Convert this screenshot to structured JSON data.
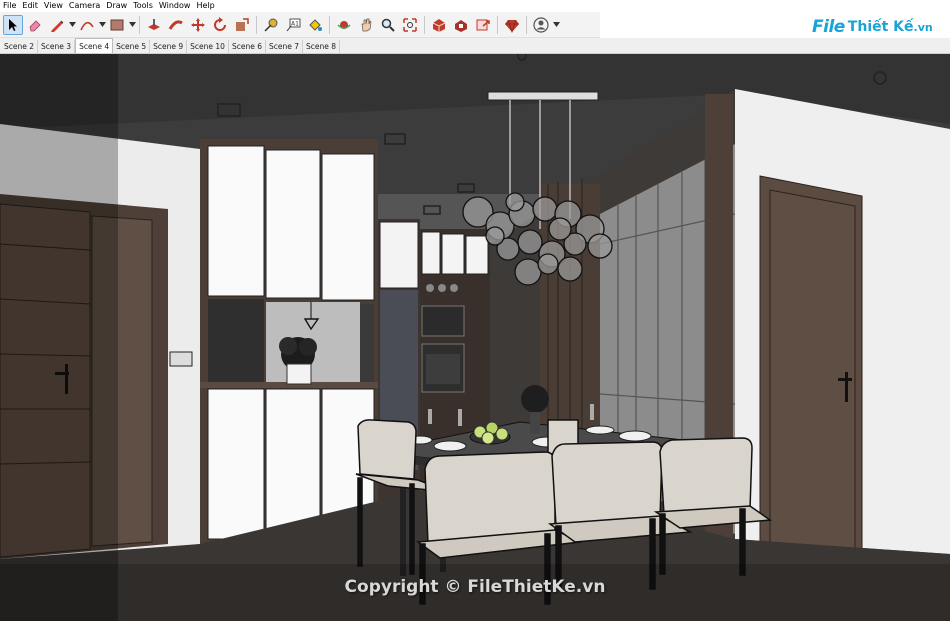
{
  "menu": {
    "items": [
      {
        "label": "File"
      },
      {
        "label": "Edit"
      },
      {
        "label": "View"
      },
      {
        "label": "Camera"
      },
      {
        "label": "Draw"
      },
      {
        "label": "Tools"
      },
      {
        "label": "Window"
      },
      {
        "label": "Help"
      }
    ]
  },
  "toolbar": {
    "tools": [
      {
        "icon": "select-arrow-icon",
        "active": true
      },
      {
        "icon": "eraser-icon"
      },
      {
        "icon": "pencil-line-icon"
      },
      {
        "icon": "arc-icon"
      },
      {
        "icon": "rectangle-icon"
      },
      {
        "icon": "push-pull-icon"
      },
      {
        "icon": "follow-me-icon"
      },
      {
        "icon": "move-icon"
      },
      {
        "icon": "rotate-icon"
      },
      {
        "icon": "scale-icon"
      },
      {
        "icon": "tape-measure-icon"
      },
      {
        "icon": "text-label-icon"
      },
      {
        "icon": "paint-bucket-icon"
      },
      {
        "icon": "orbit-icon"
      },
      {
        "icon": "pan-icon"
      },
      {
        "icon": "zoom-icon"
      },
      {
        "icon": "zoom-extents-icon"
      },
      {
        "icon": "warehouse-icon"
      },
      {
        "icon": "extension-warehouse-icon"
      },
      {
        "icon": "share-model-icon"
      },
      {
        "icon": "ruby-console-icon"
      },
      {
        "icon": "account-icon"
      }
    ]
  },
  "scenes": {
    "tabs": [
      {
        "label": "Scene 2"
      },
      {
        "label": "Scene 3"
      },
      {
        "label": "Scene 4",
        "active": true
      },
      {
        "label": "Scene 5"
      },
      {
        "label": "Scene 9"
      },
      {
        "label": "Scene 10"
      },
      {
        "label": "Scene 6"
      },
      {
        "label": "Scene 7"
      },
      {
        "label": "Scene 8"
      }
    ]
  },
  "logo": {
    "mark": "File",
    "rest": "Thiết Kế",
    "suffix": ".vn"
  },
  "watermark": {
    "text": "Copyright © FileThietKe.vn"
  },
  "colors": {
    "accent": "#1aa3d8",
    "wall_dark": "#4a4a4a",
    "wood": "#5a4a40",
    "chair_fabric": "#d9d4cc"
  }
}
